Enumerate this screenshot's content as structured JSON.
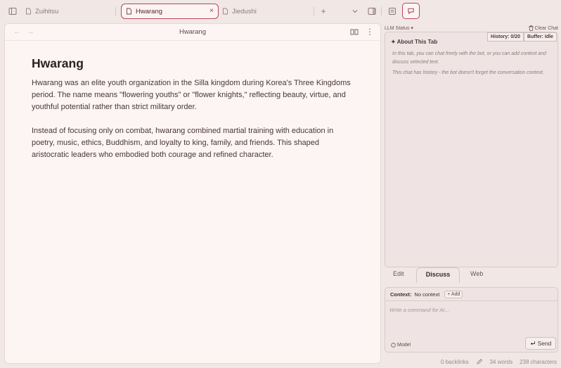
{
  "tabs": [
    {
      "label": "Zuihitsu"
    },
    {
      "label": "Hwarang",
      "close": "×"
    },
    {
      "label": "Jiedushi"
    }
  ],
  "new_tab": "+",
  "editor": {
    "title": "Hwarang",
    "back": "←",
    "forward": "→",
    "more": "⋮",
    "doc_title": "Hwarang",
    "paragraphs": [
      "Hwarang was an elite youth organization in the Silla kingdom during Korea's Three Kingdoms period. The name means \"flowering youths\" or \"flower knights,\" reflecting beauty, virtue, and youthful potential rather than strict military order.",
      "Instead of focusing only on combat, hwarang combined martial training with education in poetry, music, ethics, Buddhism, and loyalty to king, family, and friends. This shaped aristocratic leaders who embodied both courage and refined character."
    ]
  },
  "chat": {
    "llm_status": "LLM Status",
    "llm_caret": "▾",
    "clear_chat": "Clear Chat",
    "history": "History: 0/20",
    "buffer": "Buffer: Idle",
    "about_title": "✦ About This Tab",
    "about_lines": [
      "In this tab, you can chat freely with the bot, or you can add context and discuss selected text.",
      "This chat has history - the bot doesn't forget the conversation context."
    ],
    "modes": [
      "Edit",
      "Discuss",
      "Web"
    ],
    "context_label": "Context:",
    "context_value": "No context",
    "add_label": "+ Add",
    "input_placeholder": "Write a command for AI...",
    "model_label": "Model",
    "send_label": "Send"
  },
  "status": {
    "backlinks": "0 backlinks",
    "words": "34 words",
    "characters": "238 characters"
  },
  "colors": {
    "accent": "#b7475b",
    "background": "#f1e7e5",
    "pane": "#fcf5f4"
  }
}
